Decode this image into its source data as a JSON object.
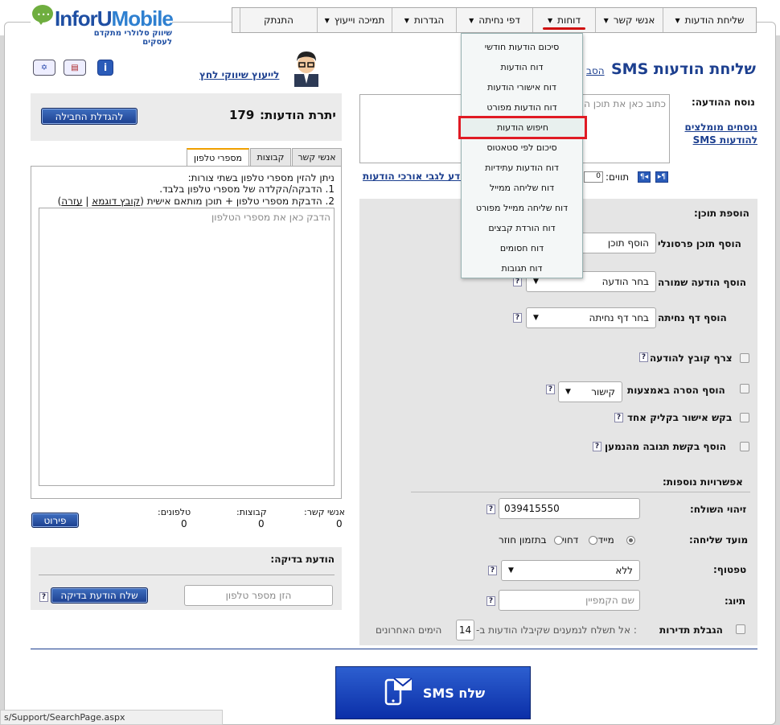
{
  "logo": {
    "name_a": "InforU",
    "name_b": "Mobile",
    "tagline": "שיווק סלולרי מתקדם לעסקים"
  },
  "nav": {
    "items": [
      {
        "label": "שליחת הודעות",
        "caret": true
      },
      {
        "label": "אנשי קשר",
        "caret": true
      },
      {
        "label": "דוחות",
        "caret": true,
        "active": true
      },
      {
        "label": "דפי נחיתה",
        "caret": true
      },
      {
        "label": "הגדרות",
        "caret": true
      },
      {
        "label": "תמיכה וייעוץ",
        "caret": true
      },
      {
        "label": "התנתק",
        "caret": false
      }
    ]
  },
  "reports_menu": {
    "items": [
      "סיכום הודעות חודשי",
      "דוח הודעות",
      "דוח אישורי הודעות",
      "דוח הודעות מפורט",
      "חיפוש הודעות",
      "סיכום לפי סטאטוס",
      "דוח הודעות עתידיות",
      "דוח שליחה ממייל",
      "דוח שליחה ממייל מפורט",
      "דוח הורדת קבצים",
      "דוח חסומים",
      "דוח תגובות"
    ],
    "highlighted": "חיפוש הודעות"
  },
  "header": {
    "title": "שליחת הודעות SMS",
    "title_link_partial": "הסב",
    "consult_link": "לייעוץ שיווקי לחץ",
    "info_icon": "i"
  },
  "balance": {
    "label": "יתרת הודעות:",
    "value": "179",
    "enlarge_button": "להגדלת החבילה"
  },
  "recipients": {
    "tabs": [
      "אנשי קשר",
      "קבוצות",
      "מספרי טלפון"
    ],
    "active_tab": "מספרי טלפון",
    "instructions_line1": "ניתן להזין מספרי טלפון בשתי צורות:",
    "instructions_line2": "1. הדבקה/הקלדה של מספרי טלפון בלבד.",
    "instructions_line3": "2. הדבקת מספרי טלפון + תוכן מותאם אישית",
    "example_link": "קובץ דוגמא",
    "help_link": "עזרה",
    "textarea_placeholder": "הדבק כאן את מספרי הטלפון",
    "counts": [
      {
        "label": "אנשי קשר:",
        "value": "0"
      },
      {
        "label": "קבוצות:",
        "value": "0"
      },
      {
        "label": "טלפונים:",
        "value": "0"
      }
    ],
    "breakdown_button": "פירוט"
  },
  "test_message": {
    "title": "הודעת בדיקה:",
    "phone_placeholder": "הזן מספר טלפון",
    "send_button": "שלח הודעת בדיקה"
  },
  "message": {
    "body_label": "נוסח ההודעה:",
    "body_placeholder": "כתוב כאן את תוכן ה",
    "recommended_link": "נוסחים מומלצים להודעות SMS",
    "chars_label": "תווים:",
    "chars_value": "0",
    "long_messages_link": "מידע לגבי אורכי הודעות"
  },
  "content": {
    "title": "הוספת תוכן:",
    "personal_label": "הוסף תוכן פרסונלי",
    "personal_select": "הוסף תוכן",
    "saved_label": "הוסף הודעה שמורה",
    "saved_select": "בחר הודעה",
    "landing_label": "הוסף דף נחיתה",
    "landing_select": "בחר דף נחיתה",
    "attach_label": "צרף קובץ להודעה",
    "unsub_label": "הוסף הסרה באמצעות",
    "unsub_select": "קישור",
    "oneclick_label": "בקש אישור בקליק אחד",
    "reply_label": "הוסף בקשת תגובה מהנמען"
  },
  "options": {
    "title": "אפשרויות נוספות:",
    "sender_label": "זיהוי השולח:",
    "sender_value": "039415550",
    "time_label": "מועד שליחה:",
    "time_now": "מיידי",
    "time_later": "דחוי",
    "time_recurring": "בתזמון חוזר",
    "footer_label": "טפטוף:",
    "footer_value": "ללא",
    "tag_label": "תיוג:",
    "tag_placeholder": "שם הקמפיין",
    "freq_label": "הגבלת תדירות",
    "freq_text_a": ": אל תשלח לנמענים שקיבלו הודעות ב-",
    "freq_days": "14",
    "freq_text_b": "הימים האחרונים"
  },
  "send_button": "שלח SMS",
  "status_url": "s/Support/SearchPage.aspx",
  "help_q": "?"
}
